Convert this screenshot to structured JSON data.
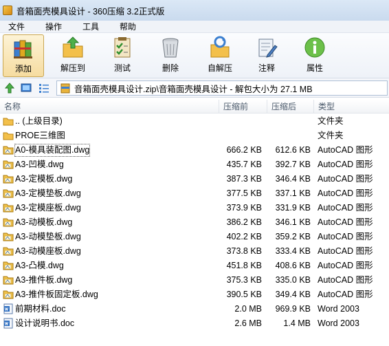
{
  "window": {
    "title": "音箱面壳模具设计 - 360压缩 3.2正式版"
  },
  "menu": [
    {
      "label": "文件"
    },
    {
      "label": "操作"
    },
    {
      "label": "工具"
    },
    {
      "label": "帮助"
    }
  ],
  "toolbar": {
    "items": [
      {
        "label": "添加",
        "icon": "add-books-icon",
        "active": true
      },
      {
        "label": "解压到",
        "icon": "extract-folder-icon"
      },
      {
        "label": "测试",
        "icon": "test-checklist-icon"
      },
      {
        "label": "删除",
        "icon": "delete-trash-icon"
      },
      {
        "label": "自解压",
        "icon": "self-extract-icon"
      },
      {
        "label": "注释",
        "icon": "comment-notepad-icon"
      },
      {
        "label": "属性",
        "icon": "info-icon"
      }
    ]
  },
  "address": {
    "path": "音箱面壳模具设计.zip\\音箱面壳模具设计 - 解包大小为 27.1 MB"
  },
  "columns": {
    "name": "名称",
    "size": "压缩前",
    "packed": "压缩后",
    "type": "类型"
  },
  "files": [
    {
      "name": ".. (上级目录)",
      "size": "",
      "packed": "",
      "type": "文件夹",
      "icon": "folder-icon"
    },
    {
      "name": "PROE三维图",
      "size": "",
      "packed": "",
      "type": "文件夹",
      "icon": "folder-icon"
    },
    {
      "name": "A0-模具装配图.dwg",
      "size": "666.2 KB",
      "packed": "612.6 KB",
      "type": "AutoCAD 图形",
      "icon": "dwg-file-icon",
      "selected": true
    },
    {
      "name": "A3-凹模.dwg",
      "size": "435.7 KB",
      "packed": "392.7 KB",
      "type": "AutoCAD 图形",
      "icon": "dwg-file-icon"
    },
    {
      "name": "A3-定模板.dwg",
      "size": "387.3 KB",
      "packed": "346.4 KB",
      "type": "AutoCAD 图形",
      "icon": "dwg-file-icon"
    },
    {
      "name": "A3-定模垫板.dwg",
      "size": "377.5 KB",
      "packed": "337.1 KB",
      "type": "AutoCAD 图形",
      "icon": "dwg-file-icon"
    },
    {
      "name": "A3-定模座板.dwg",
      "size": "373.9 KB",
      "packed": "331.9 KB",
      "type": "AutoCAD 图形",
      "icon": "dwg-file-icon"
    },
    {
      "name": "A3-动模板.dwg",
      "size": "386.2 KB",
      "packed": "346.1 KB",
      "type": "AutoCAD 图形",
      "icon": "dwg-file-icon"
    },
    {
      "name": "A3-动模垫板.dwg",
      "size": "402.2 KB",
      "packed": "359.2 KB",
      "type": "AutoCAD 图形",
      "icon": "dwg-file-icon"
    },
    {
      "name": "A3-动模座板.dwg",
      "size": "373.8 KB",
      "packed": "333.4 KB",
      "type": "AutoCAD 图形",
      "icon": "dwg-file-icon"
    },
    {
      "name": "A3-凸模.dwg",
      "size": "451.8 KB",
      "packed": "408.6 KB",
      "type": "AutoCAD 图形",
      "icon": "dwg-file-icon"
    },
    {
      "name": "A3-推件板.dwg",
      "size": "375.3 KB",
      "packed": "335.0 KB",
      "type": "AutoCAD 图形",
      "icon": "dwg-file-icon"
    },
    {
      "name": "A3-推件板固定板.dwg",
      "size": "390.5 KB",
      "packed": "349.4 KB",
      "type": "AutoCAD 图形",
      "icon": "dwg-file-icon"
    },
    {
      "name": "前期材料.doc",
      "size": "2.0 MB",
      "packed": "969.9 KB",
      "type": "Word 2003",
      "icon": "doc-file-icon"
    },
    {
      "name": "设计说明书.doc",
      "size": "2.6 MB",
      "packed": "1.4 MB",
      "type": "Word 2003",
      "icon": "doc-file-icon"
    }
  ]
}
